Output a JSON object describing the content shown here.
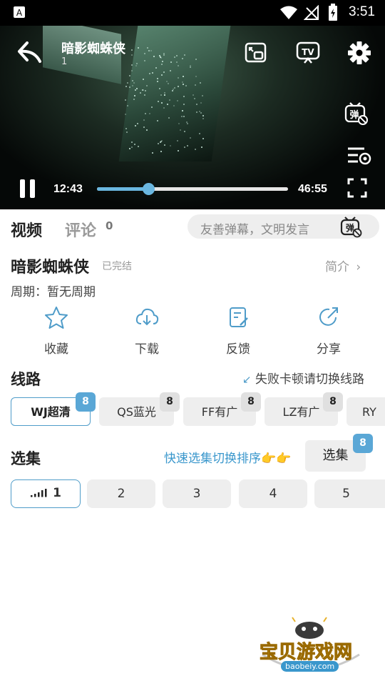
{
  "statusbar": {
    "time": "3:51"
  },
  "player": {
    "title": "暗影蜘蛛侠",
    "episode": "1",
    "current_time": "12:43",
    "total_time": "46:55",
    "progress": 0.27
  },
  "tabs": {
    "video": "视频",
    "comments": "评论",
    "comments_count": "0"
  },
  "danmu": {
    "placeholder": "友善弹幕，文明发言"
  },
  "show": {
    "title": "暗影蜘蛛侠",
    "status": "已完结",
    "intro": "简介",
    "cycle": "周期：暂无周期"
  },
  "actions": {
    "favorite": "收藏",
    "download": "下载",
    "feedback": "反馈",
    "share": "分享"
  },
  "routes": {
    "title": "线路",
    "hint": "失败卡顿请切换线路",
    "items": [
      {
        "label": "WJ超清",
        "badge": "8"
      },
      {
        "label": "QS蓝光",
        "badge": "8"
      },
      {
        "label": "FF有广",
        "badge": "8"
      },
      {
        "label": "LZ有广",
        "badge": "8"
      },
      {
        "label": "RY"
      }
    ]
  },
  "episodes": {
    "title": "选集",
    "hint": "快速选集切换排序👉👉",
    "button": "选集",
    "button_badge": "8",
    "items": [
      "1",
      "2",
      "3",
      "4",
      "5"
    ]
  },
  "watermark": {
    "text": "宝贝游戏网",
    "url": "baobeiy.com"
  }
}
